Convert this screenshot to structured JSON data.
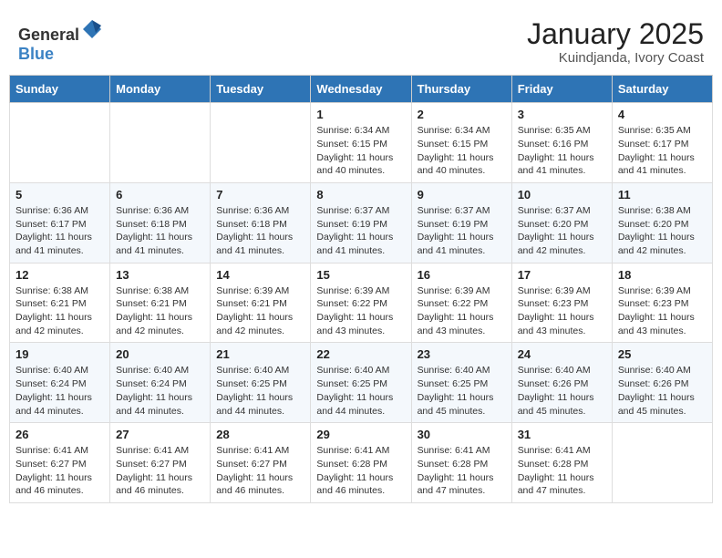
{
  "header": {
    "logo_general": "General",
    "logo_blue": "Blue",
    "title": "January 2025",
    "subtitle": "Kuindjanda, Ivory Coast"
  },
  "days_of_week": [
    "Sunday",
    "Monday",
    "Tuesday",
    "Wednesday",
    "Thursday",
    "Friday",
    "Saturday"
  ],
  "weeks": [
    [
      {
        "day": "",
        "info": ""
      },
      {
        "day": "",
        "info": ""
      },
      {
        "day": "",
        "info": ""
      },
      {
        "day": "1",
        "info": "Sunrise: 6:34 AM\nSunset: 6:15 PM\nDaylight: 11 hours\nand 40 minutes."
      },
      {
        "day": "2",
        "info": "Sunrise: 6:34 AM\nSunset: 6:15 PM\nDaylight: 11 hours\nand 40 minutes."
      },
      {
        "day": "3",
        "info": "Sunrise: 6:35 AM\nSunset: 6:16 PM\nDaylight: 11 hours\nand 41 minutes."
      },
      {
        "day": "4",
        "info": "Sunrise: 6:35 AM\nSunset: 6:17 PM\nDaylight: 11 hours\nand 41 minutes."
      }
    ],
    [
      {
        "day": "5",
        "info": "Sunrise: 6:36 AM\nSunset: 6:17 PM\nDaylight: 11 hours\nand 41 minutes."
      },
      {
        "day": "6",
        "info": "Sunrise: 6:36 AM\nSunset: 6:18 PM\nDaylight: 11 hours\nand 41 minutes."
      },
      {
        "day": "7",
        "info": "Sunrise: 6:36 AM\nSunset: 6:18 PM\nDaylight: 11 hours\nand 41 minutes."
      },
      {
        "day": "8",
        "info": "Sunrise: 6:37 AM\nSunset: 6:19 PM\nDaylight: 11 hours\nand 41 minutes."
      },
      {
        "day": "9",
        "info": "Sunrise: 6:37 AM\nSunset: 6:19 PM\nDaylight: 11 hours\nand 41 minutes."
      },
      {
        "day": "10",
        "info": "Sunrise: 6:37 AM\nSunset: 6:20 PM\nDaylight: 11 hours\nand 42 minutes."
      },
      {
        "day": "11",
        "info": "Sunrise: 6:38 AM\nSunset: 6:20 PM\nDaylight: 11 hours\nand 42 minutes."
      }
    ],
    [
      {
        "day": "12",
        "info": "Sunrise: 6:38 AM\nSunset: 6:21 PM\nDaylight: 11 hours\nand 42 minutes."
      },
      {
        "day": "13",
        "info": "Sunrise: 6:38 AM\nSunset: 6:21 PM\nDaylight: 11 hours\nand 42 minutes."
      },
      {
        "day": "14",
        "info": "Sunrise: 6:39 AM\nSunset: 6:21 PM\nDaylight: 11 hours\nand 42 minutes."
      },
      {
        "day": "15",
        "info": "Sunrise: 6:39 AM\nSunset: 6:22 PM\nDaylight: 11 hours\nand 43 minutes."
      },
      {
        "day": "16",
        "info": "Sunrise: 6:39 AM\nSunset: 6:22 PM\nDaylight: 11 hours\nand 43 minutes."
      },
      {
        "day": "17",
        "info": "Sunrise: 6:39 AM\nSunset: 6:23 PM\nDaylight: 11 hours\nand 43 minutes."
      },
      {
        "day": "18",
        "info": "Sunrise: 6:39 AM\nSunset: 6:23 PM\nDaylight: 11 hours\nand 43 minutes."
      }
    ],
    [
      {
        "day": "19",
        "info": "Sunrise: 6:40 AM\nSunset: 6:24 PM\nDaylight: 11 hours\nand 44 minutes."
      },
      {
        "day": "20",
        "info": "Sunrise: 6:40 AM\nSunset: 6:24 PM\nDaylight: 11 hours\nand 44 minutes."
      },
      {
        "day": "21",
        "info": "Sunrise: 6:40 AM\nSunset: 6:25 PM\nDaylight: 11 hours\nand 44 minutes."
      },
      {
        "day": "22",
        "info": "Sunrise: 6:40 AM\nSunset: 6:25 PM\nDaylight: 11 hours\nand 44 minutes."
      },
      {
        "day": "23",
        "info": "Sunrise: 6:40 AM\nSunset: 6:25 PM\nDaylight: 11 hours\nand 45 minutes."
      },
      {
        "day": "24",
        "info": "Sunrise: 6:40 AM\nSunset: 6:26 PM\nDaylight: 11 hours\nand 45 minutes."
      },
      {
        "day": "25",
        "info": "Sunrise: 6:40 AM\nSunset: 6:26 PM\nDaylight: 11 hours\nand 45 minutes."
      }
    ],
    [
      {
        "day": "26",
        "info": "Sunrise: 6:41 AM\nSunset: 6:27 PM\nDaylight: 11 hours\nand 46 minutes."
      },
      {
        "day": "27",
        "info": "Sunrise: 6:41 AM\nSunset: 6:27 PM\nDaylight: 11 hours\nand 46 minutes."
      },
      {
        "day": "28",
        "info": "Sunrise: 6:41 AM\nSunset: 6:27 PM\nDaylight: 11 hours\nand 46 minutes."
      },
      {
        "day": "29",
        "info": "Sunrise: 6:41 AM\nSunset: 6:28 PM\nDaylight: 11 hours\nand 46 minutes."
      },
      {
        "day": "30",
        "info": "Sunrise: 6:41 AM\nSunset: 6:28 PM\nDaylight: 11 hours\nand 47 minutes."
      },
      {
        "day": "31",
        "info": "Sunrise: 6:41 AM\nSunset: 6:28 PM\nDaylight: 11 hours\nand 47 minutes."
      },
      {
        "day": "",
        "info": ""
      }
    ]
  ]
}
